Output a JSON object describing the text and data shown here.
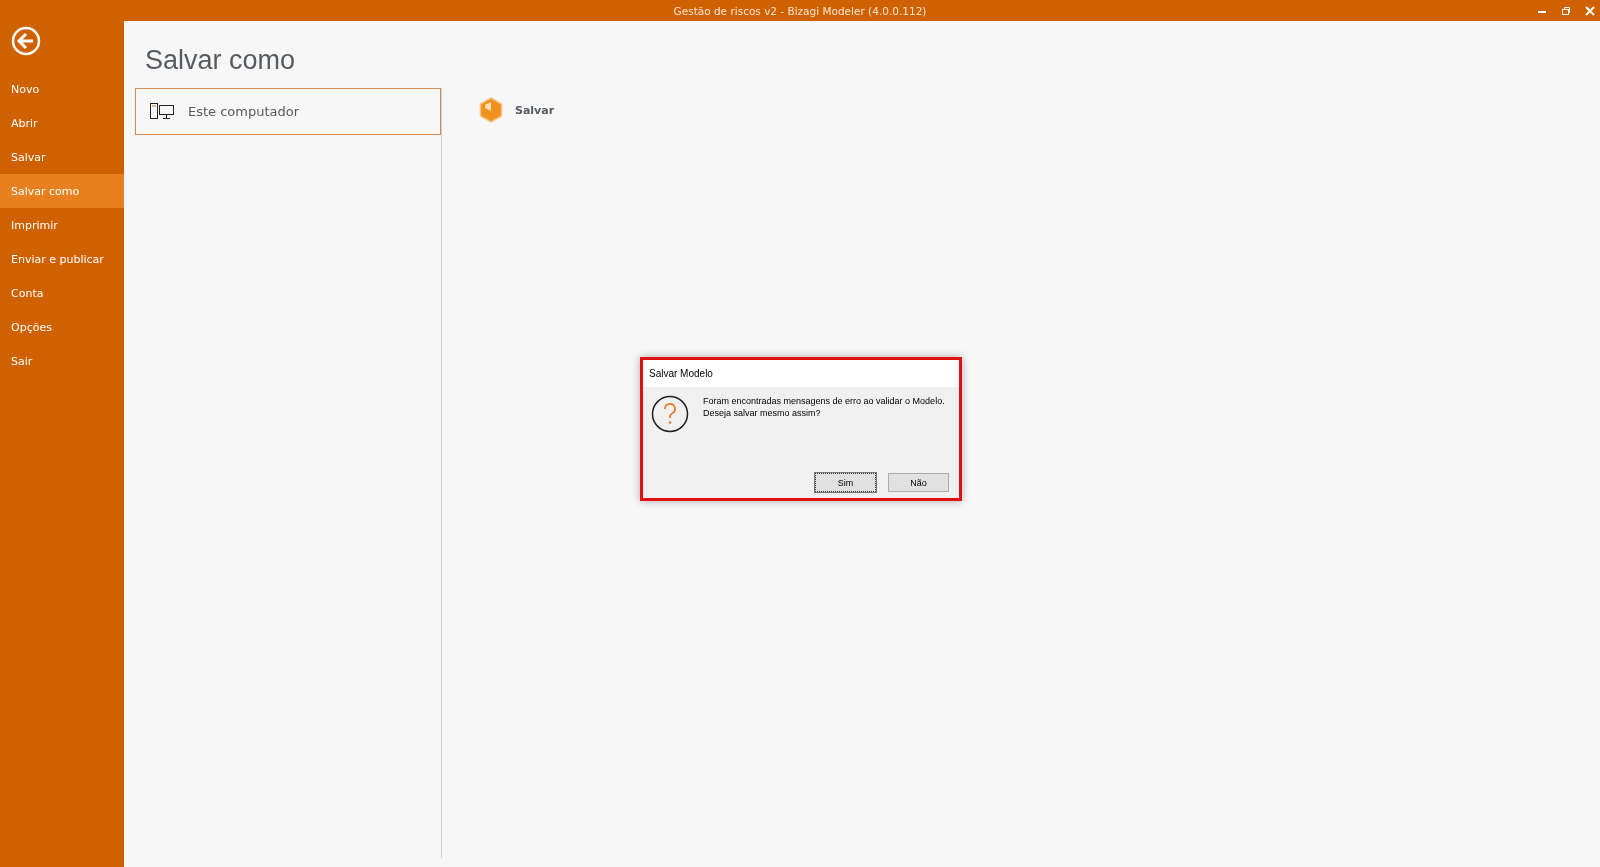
{
  "window": {
    "title": "Gestão de riscos v2 - Bizagi Modeler (4.0.0.112)"
  },
  "sidebar": {
    "items": [
      {
        "label": "Novo",
        "selected": false
      },
      {
        "label": "Abrir",
        "selected": false
      },
      {
        "label": "Salvar",
        "selected": false
      },
      {
        "label": "Salvar como",
        "selected": true
      },
      {
        "label": "Imprimir",
        "selected": false
      },
      {
        "label": "Enviar e publicar",
        "selected": false
      },
      {
        "label": "Conta",
        "selected": false
      },
      {
        "label": "Opções",
        "selected": false
      },
      {
        "label": "Sair",
        "selected": false
      }
    ]
  },
  "page": {
    "title": "Salvar como",
    "locations": [
      {
        "label": "Este computador",
        "selected": true
      }
    ],
    "actions": [
      {
        "label": "Salvar"
      }
    ]
  },
  "dialog": {
    "title": "Salvar Modelo",
    "message": [
      "Foram encontradas mensagens de erro ao validar o Modelo.",
      "Deseja salvar mesmo assim?"
    ],
    "buttons": [
      {
        "label": "Sim",
        "selected": true
      },
      {
        "label": "Não",
        "selected": false
      }
    ]
  }
}
